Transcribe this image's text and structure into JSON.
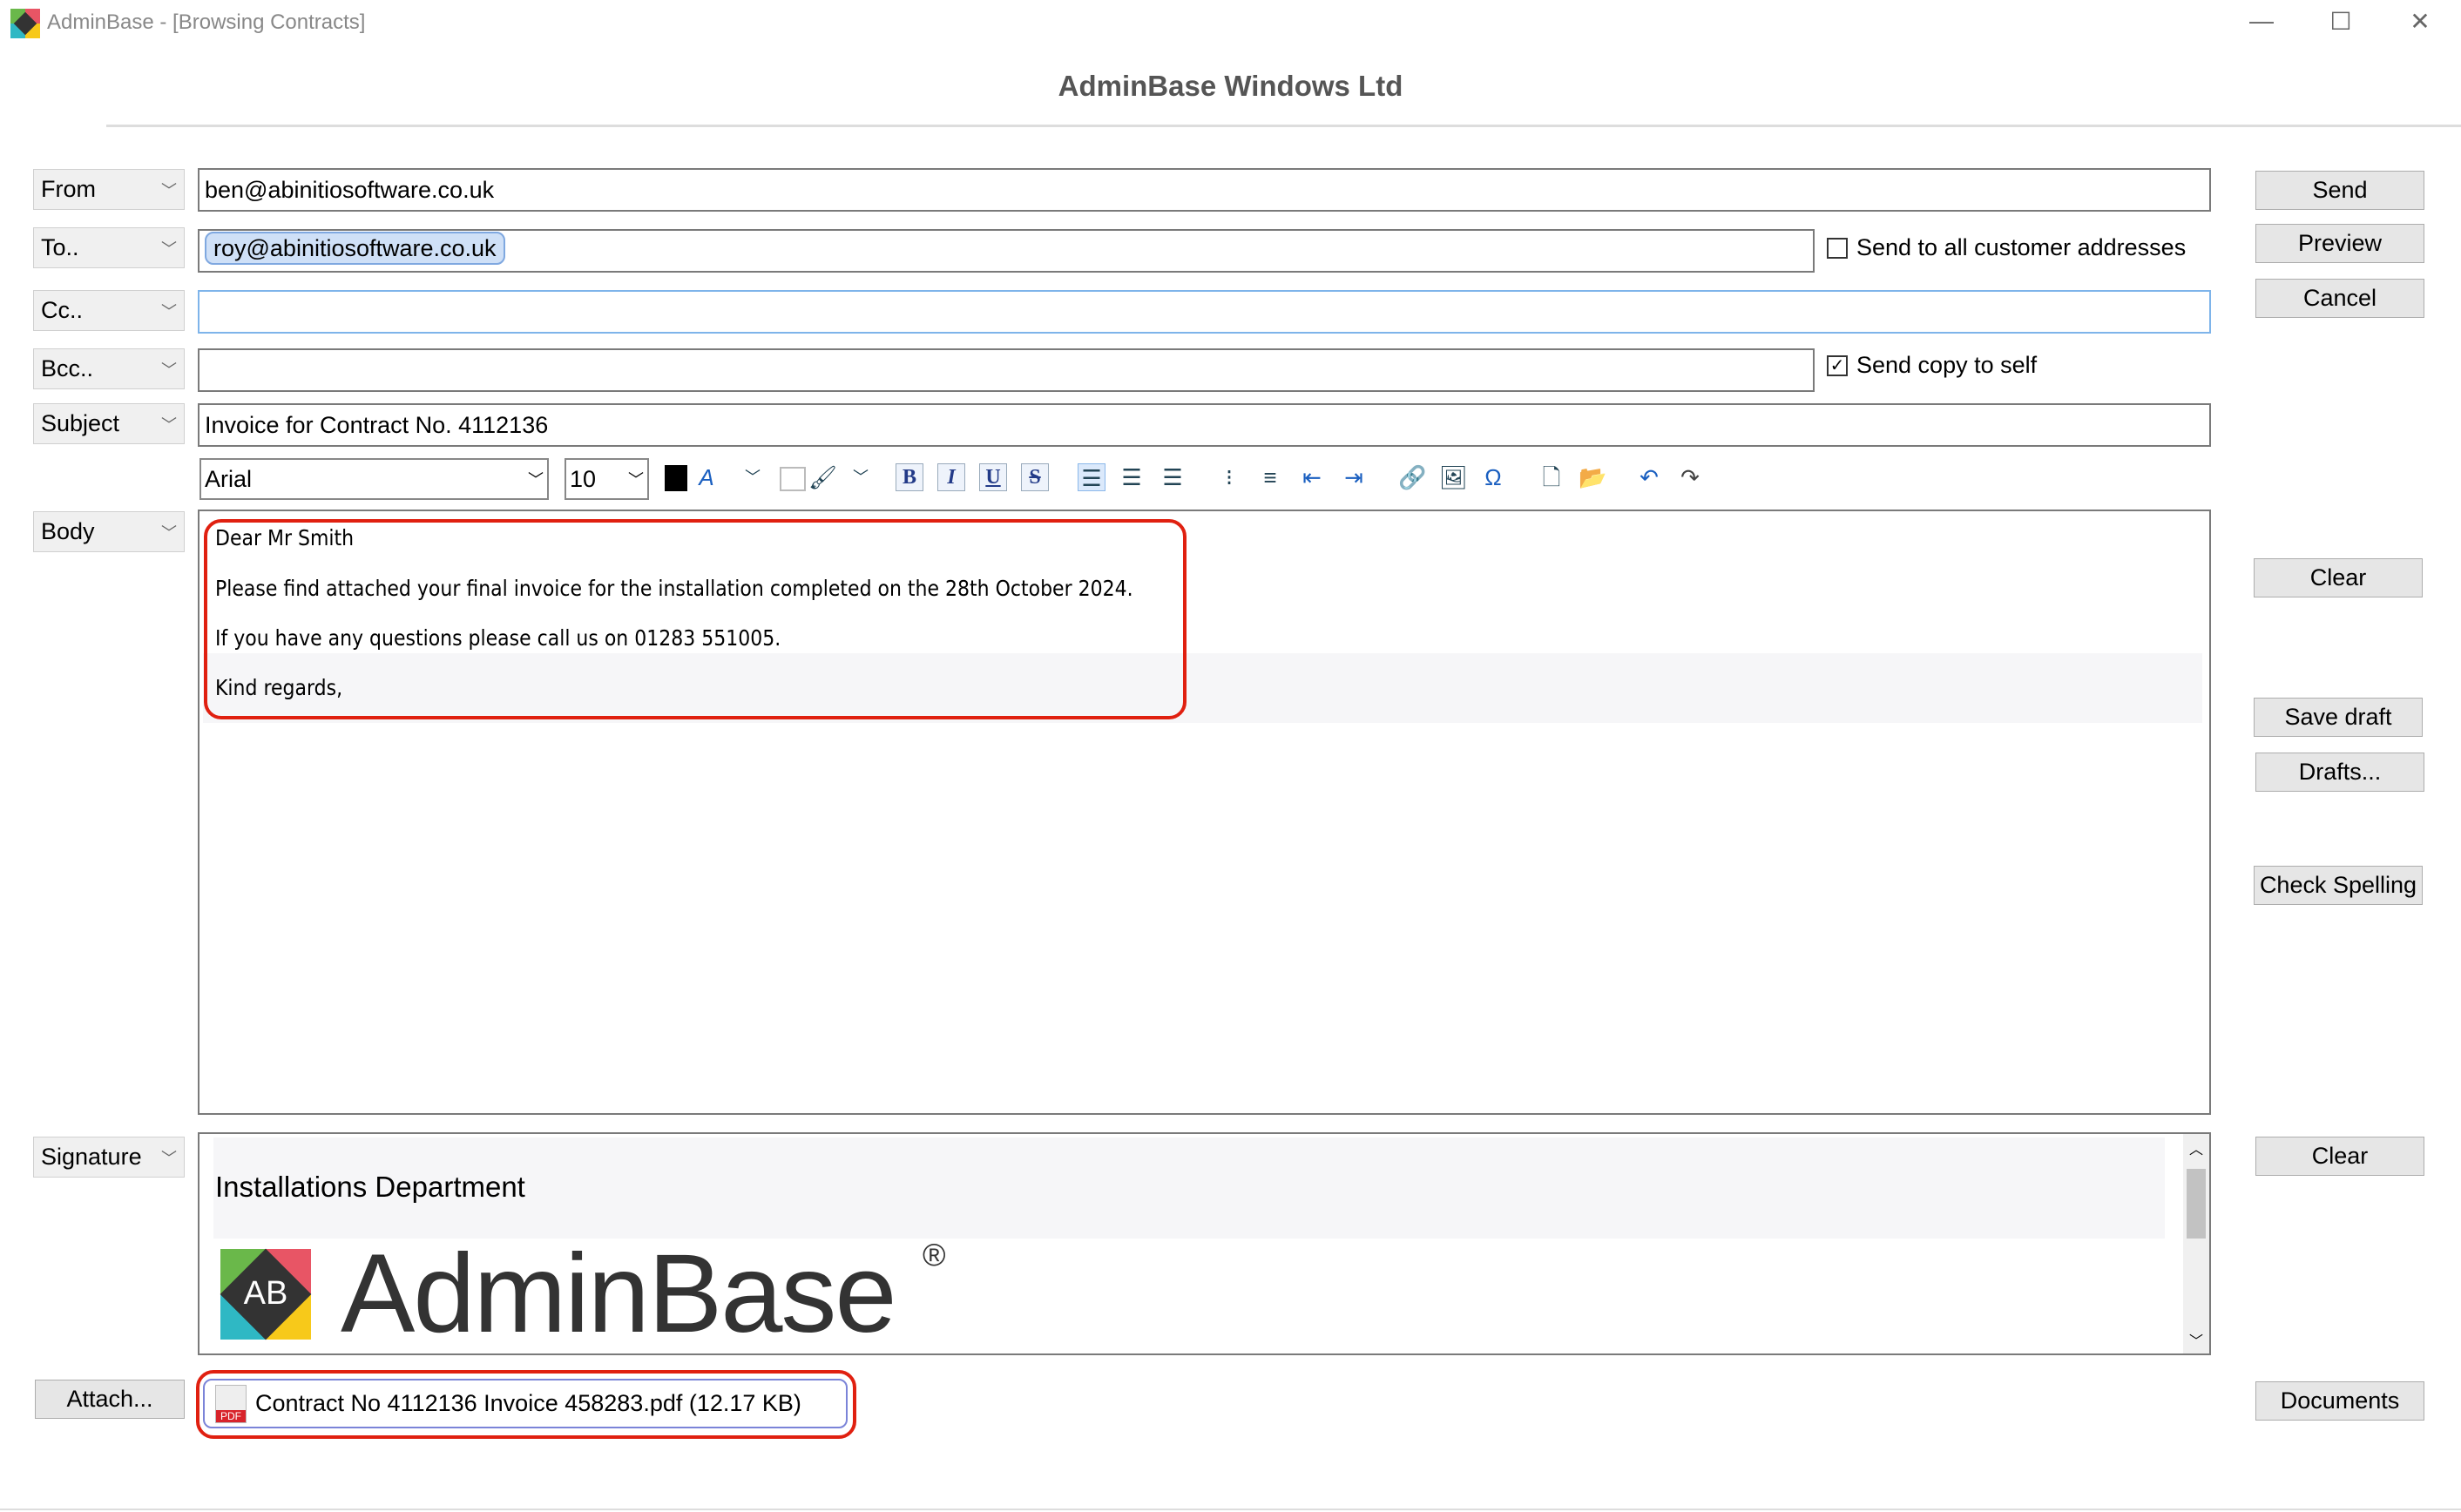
{
  "window": {
    "title": "AdminBase - [Browsing Contracts]",
    "minimize": "—",
    "maximize": "☐",
    "close": "✕"
  },
  "company": "AdminBase Windows Ltd",
  "fields": {
    "from": {
      "label": "From",
      "value": "ben@abinitiosoftware.co.uk"
    },
    "to": {
      "label": "To..",
      "value": "roy@abinitiosoftware.co.uk"
    },
    "cc": {
      "label": "Cc..",
      "value": ""
    },
    "bcc": {
      "label": "Bcc..",
      "value": ""
    },
    "subject": {
      "label": "Subject",
      "value": "Invoice for Contract No. 4112136"
    },
    "body_label": "Body",
    "signature_label": "Signature"
  },
  "options": {
    "send_all": {
      "label": "Send to all customer addresses",
      "checked": false
    },
    "copy_self": {
      "label": "Send copy to self",
      "checked": true
    }
  },
  "toolbar": {
    "font": "Arial",
    "size": "10"
  },
  "body": [
    "Dear Mr Smith",
    "Please find attached your final invoice for the installation completed on the 28th October 2024.",
    "If you have any questions please call us on 01283 551005.",
    "Kind regards,"
  ],
  "signature": {
    "department": "Installations Department",
    "logo_text": "AdminBase",
    "logo_mark": "AB",
    "registered": "®"
  },
  "attachment": {
    "button": "Attach...",
    "file": "Contract No 4112136 Invoice 458283.pdf (12.17 KB)",
    "icon_label": "PDF"
  },
  "buttons": {
    "send": "Send",
    "preview": "Preview",
    "cancel": "Cancel",
    "clear_body": "Clear",
    "save_draft": "Save draft",
    "drafts": "Drafts...",
    "check_spelling": "Check Spelling",
    "clear_signature": "Clear",
    "documents": "Documents"
  },
  "colors": {
    "highlight": "#e02010",
    "chip": "#cfe0f7"
  }
}
